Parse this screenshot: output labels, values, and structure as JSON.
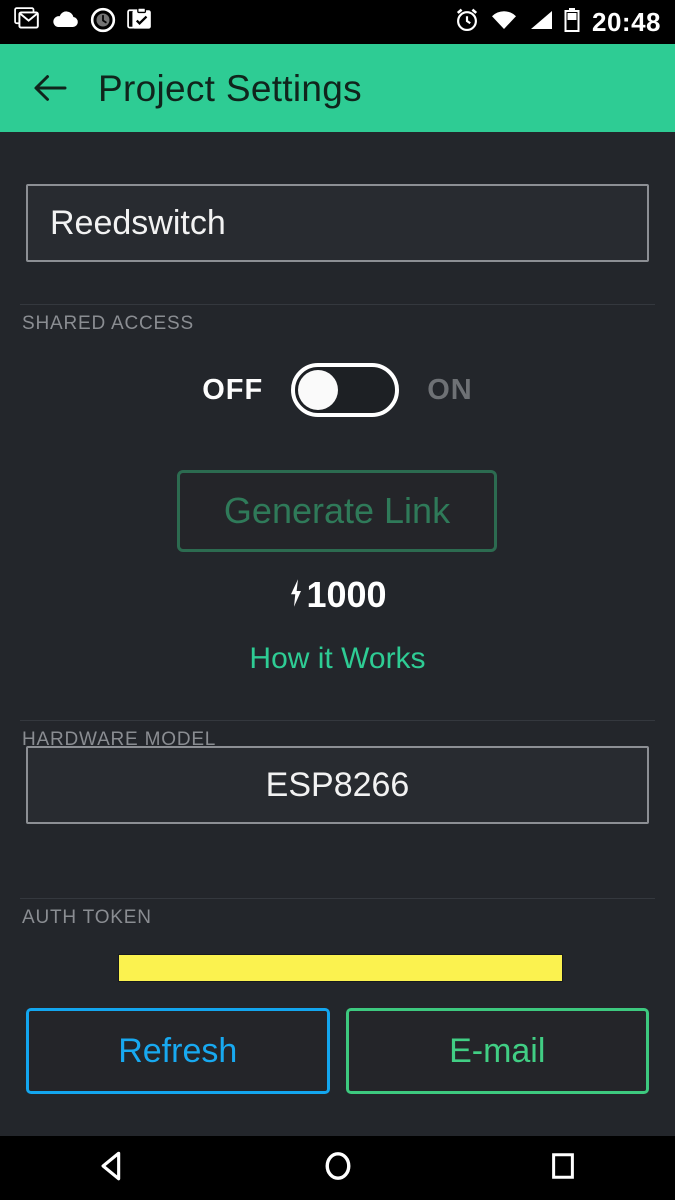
{
  "status_bar": {
    "time": "20:48",
    "left_icons": [
      "gmail-icon",
      "cloud-icon",
      "clock-circle-icon",
      "clipboard-check-icon"
    ],
    "right_icons": [
      "alarm-icon",
      "wifi-icon",
      "cellular-signal-icon",
      "battery-icon"
    ]
  },
  "app_bar": {
    "back_icon": "back-arrow-icon",
    "title": "Project Settings"
  },
  "project_name": {
    "value": "Reedswitch"
  },
  "shared_access": {
    "section_label": "SHARED ACCESS",
    "toggle_off_label": "OFF",
    "toggle_on_label": "ON",
    "toggle_state": "off",
    "generate_link_label": "Generate Link",
    "generate_link_enabled": false,
    "energy_icon": "energy-bolt-icon",
    "energy_cost": "1000",
    "how_it_works_label": "How it Works"
  },
  "hardware_model": {
    "section_label": "HARDWARE MODEL",
    "value": "ESP8266"
  },
  "auth_token": {
    "section_label": "AUTH TOKEN",
    "value": "••••••••••••••••••••••••••••••••",
    "redacted": true,
    "redaction_color": "#fbf24f",
    "refresh_label": "Refresh",
    "email_label": "E-mail"
  },
  "nav_bar": {
    "back_icon": "nav-back-icon",
    "home_icon": "nav-home-icon",
    "recents_icon": "nav-recents-icon"
  },
  "colors": {
    "accent_green": "#2ecc94",
    "background": "#23262b",
    "refresh_blue": "#13a6ef",
    "email_green": "#3dc97f",
    "disabled_green": "#2c6b50",
    "highlight_yellow": "#fbf24f"
  }
}
